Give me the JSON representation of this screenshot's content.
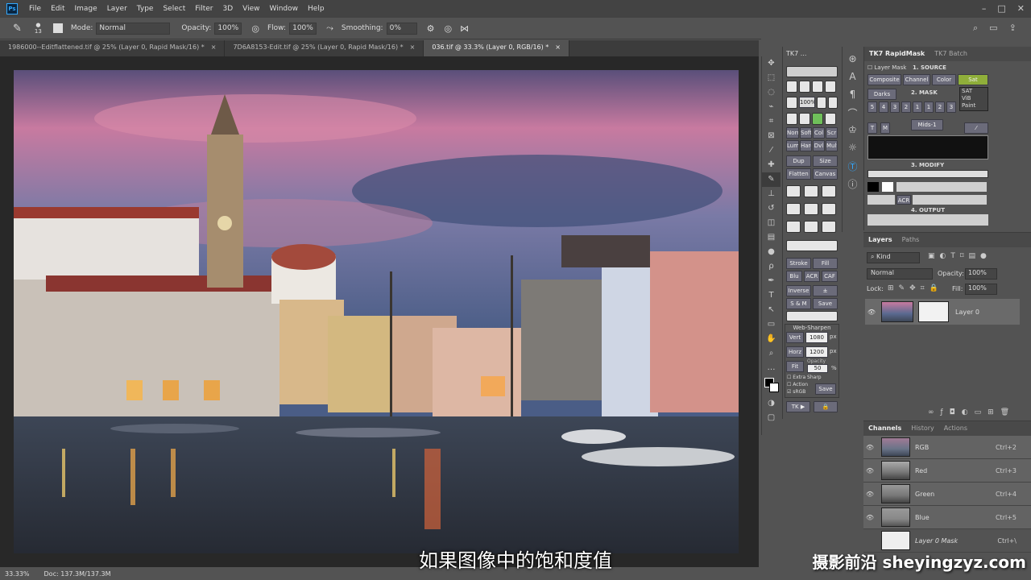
{
  "app": {
    "logo": "Ps"
  },
  "menu": [
    "File",
    "Edit",
    "Image",
    "Layer",
    "Type",
    "Select",
    "Filter",
    "3D",
    "View",
    "Window",
    "Help"
  ],
  "options": {
    "brush_size": "13",
    "mode_label": "Mode:",
    "mode_value": "Normal",
    "opacity_label": "Opacity:",
    "opacity_value": "100%",
    "flow_label": "Flow:",
    "flow_value": "100%",
    "smoothing_label": "Smoothing:",
    "smoothing_value": "0%"
  },
  "tabs": [
    {
      "label": "1986000--Editflattened.tif @ 25% (Layer 0, Rapid Mask/16) *",
      "close": "×"
    },
    {
      "label": "7D6A8153-Edit.tif @ 25% (Layer 0, Rapid Mask/16) *",
      "close": "×"
    },
    {
      "label": "036.tif @ 33.3% (Layer 0, RGB/16) *",
      "close": "×"
    }
  ],
  "status": {
    "zoom": "33.33%",
    "doc": "Doc: 137.3M/137.3M"
  },
  "subtitle": "如果图像中的饱和度值",
  "watermark": "摄影前沿 sheyingzyz.com",
  "tk7": {
    "title": "TK7 ...",
    "pct": "100%",
    "blend_row1": [
      "Norm",
      "Soft",
      "Col",
      "Scr"
    ],
    "blend_row2": [
      "Lum",
      "Hard",
      "Dvl",
      "Mult"
    ],
    "btn_dup": "Dup Img",
    "btn_size": "Size",
    "btn_flatten": "Flatten",
    "btn_canvas": "Canvas",
    "btn_stroke": "Stroke",
    "btn_fill": "Fill",
    "btn_blu": "Blu",
    "btn_acr": "ACR",
    "btn_caf": "CAF",
    "btn_inverse": "Inverse",
    "btn_select": "± Select",
    "btn_sm": "S & M",
    "btn_save": "Save",
    "web_sharpen": "Web-Sharpen",
    "vert_label": "Vert",
    "vert_value": "1080",
    "horz_label": "Horz",
    "horz_value": "1200",
    "px": "px",
    "fit_label": "Fit",
    "opacity_label": "Opacity",
    "opacity_value": "50",
    "pct_sign": "%",
    "extra_sharp": "Extra Sharp",
    "action": "Action",
    "srgb": "sRGB",
    "save2": "Save",
    "tk_footer": "TK ▶"
  },
  "rapid": {
    "tab1": "TK7 RapidMask",
    "tab2": "TK7 Batch",
    "layer_mask": "Layer Mask",
    "source": "1. SOURCE",
    "composite": "Composite",
    "channel": "Channel",
    "color": "Color",
    "sat": "Sat",
    "menu_items": [
      "SAT",
      "ViB",
      "Paint"
    ],
    "darks": "Darks",
    "mask": "2. MASK",
    "digits": [
      "5",
      "4",
      "3",
      "2",
      "1",
      "1",
      "2",
      "3"
    ],
    "t": "T",
    "m": "M",
    "mids": "Mids-1",
    "modify": "3. MODIFY",
    "output": "4. OUTPUT",
    "acr": "ACR"
  },
  "layers": {
    "tab1": "Layers",
    "tab2": "Paths",
    "kind": "Kind",
    "blend": "Normal",
    "opacity_label": "Opacity:",
    "opacity_value": "100%",
    "lock_label": "Lock:",
    "fill_label": "Fill:",
    "fill_value": "100%",
    "layer_name": "Layer 0"
  },
  "channels": {
    "tab1": "Channels",
    "tab2": "History",
    "tab3": "Actions",
    "rows": [
      {
        "name": "RGB",
        "shortcut": "Ctrl+2"
      },
      {
        "name": "Red",
        "shortcut": "Ctrl+3"
      },
      {
        "name": "Green",
        "shortcut": "Ctrl+4"
      },
      {
        "name": "Blue",
        "shortcut": "Ctrl+5"
      },
      {
        "name": "Layer 0 Mask",
        "shortcut": "Ctrl+\\"
      }
    ]
  },
  "colors": {
    "accent": "#31a8ff",
    "tk_button": "#6b6b7a",
    "tk_red": "#8a3a3a"
  }
}
